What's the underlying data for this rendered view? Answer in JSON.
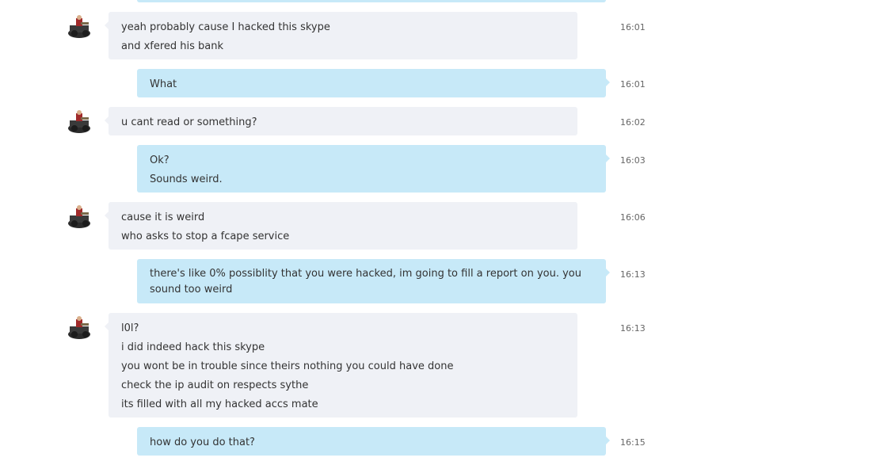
{
  "conversation": {
    "messages": [
      {
        "direction": "in",
        "time": "16:01",
        "lines": [
          "yeah probably cause I hacked this skype",
          "and xfered his bank"
        ]
      },
      {
        "direction": "out",
        "time": "16:01",
        "lines": [
          "What"
        ]
      },
      {
        "direction": "in",
        "time": "16:02",
        "lines": [
          "u cant read or something?"
        ]
      },
      {
        "direction": "out",
        "time": "16:03",
        "lines": [
          "Ok?",
          "Sounds weird."
        ]
      },
      {
        "direction": "in",
        "time": "16:06",
        "lines": [
          "cause it is weird",
          "who asks to stop a fcape service"
        ]
      },
      {
        "direction": "out",
        "time": "16:13",
        "lines": [
          "there's like 0% possiblity that you were hacked, im going to fill a report on you. you sound too weird"
        ]
      },
      {
        "direction": "in",
        "time": "16:13",
        "lines": [
          "l0l?",
          "i did indeed hack this skype",
          "you wont be in trouble since theirs nothing you could have done",
          "check the ip audit on respects sythe",
          "its filled with all my hacked accs mate"
        ]
      },
      {
        "direction": "out",
        "time": "16:15",
        "lines": [
          "how do you do that?"
        ]
      }
    ]
  },
  "avatar_icon": "contact-avatar-icon",
  "colors": {
    "incoming_bubble": "#eff1f6",
    "outgoing_bubble": "#c7e9f8",
    "text": "#333333",
    "timestamp": "#666666"
  }
}
